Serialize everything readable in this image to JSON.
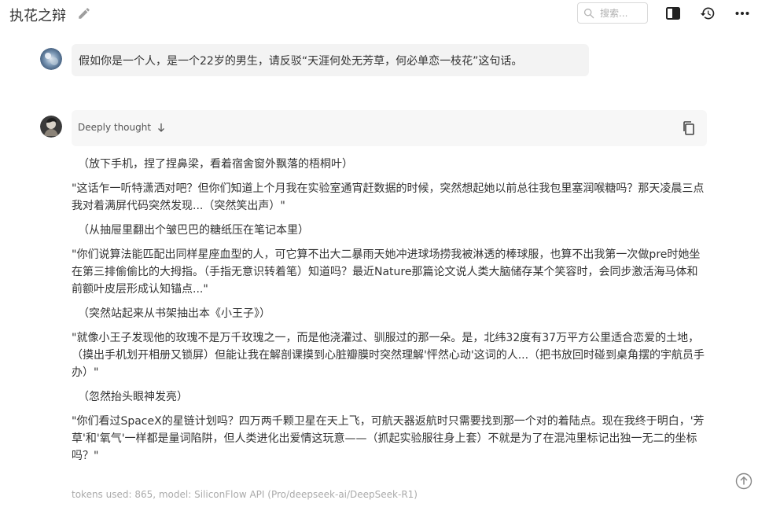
{
  "header": {
    "title": "执花之辩",
    "search_placeholder": "搜索..."
  },
  "user_message": {
    "text": "假如你是一个人，是一个22岁的男生，请反驳“天涯何处无芳草，何必单恋一枝花”这句话。"
  },
  "assistant": {
    "thought_label": "Deeply thought",
    "paragraphs": [
      "（放下手机，捏了捏鼻梁，看着宿舍窗外飘落的梧桐叶）",
      "\"这话乍一听特潇洒对吧？但你们知道上个月我在实验室通宵赶数据的时候，突然想起她以前总往我包里塞润喉糖吗？那天凌晨三点我对着满屏代码突然发现...（突然笑出声）\"",
      "（从抽屉里翻出个皱巴巴的糖纸压在笔记本里）",
      "\"你们说算法能匹配出同样星座血型的人，可它算不出大二暴雨天她冲进球场捞我被淋透的棒球服，也算不出我第一次做pre时她坐在第三排偷偷比的大拇指。（手指无意识转着笔）知道吗？最近Nature那篇论文说人类大脑储存某个笑容时，会同步激活海马体和前额叶皮层形成认知锚点...\"",
      "（突然站起来从书架抽出本《小王子》）",
      "\"就像小王子发现他的玫瑰不是万千玫瑰之一，而是他浇灌过、驯服过的那一朵。是，北纬32度有37万平方公里适合恋爱的土地，（摸出手机划开相册又锁屏）但能让我在解剖课摸到心脏瓣膜时突然理解'怦然心动'这词的人...（把书放回时碰到桌角摆的宇航员手办）\"",
      "（忽然抬头眼神发亮）",
      "\"你们看过SpaceX的星链计划吗？四万两千颗卫星在天上飞，可航天器返航时只需要找到那一个对的着陆点。现在我终于明白，'芳草'和'氧气'一样都是量词陷阱，但人类进化出爱情这玩意——（抓起实验服往身上套）不就是为了在混沌里标记出独一无二的坐标吗？\""
    ],
    "meta": "tokens used: 865, model: SiliconFlow API (Pro/deepseek-ai/DeepSeek-R1)"
  },
  "icons": {
    "edit": "pencil-icon",
    "search": "search-icon",
    "sidebar": "sidebar-toggle-icon",
    "history": "history-icon",
    "more": "more-horizontal-icon",
    "thought_arrow": "arrow-down-icon",
    "copy": "copy-icon",
    "scroll_top": "scroll-to-top-icon"
  },
  "colors": {
    "user_bubble": "#f3f3f3",
    "thought_bar": "#f7f7f7",
    "text": "#333333",
    "meta_text": "#aaaaaa"
  }
}
